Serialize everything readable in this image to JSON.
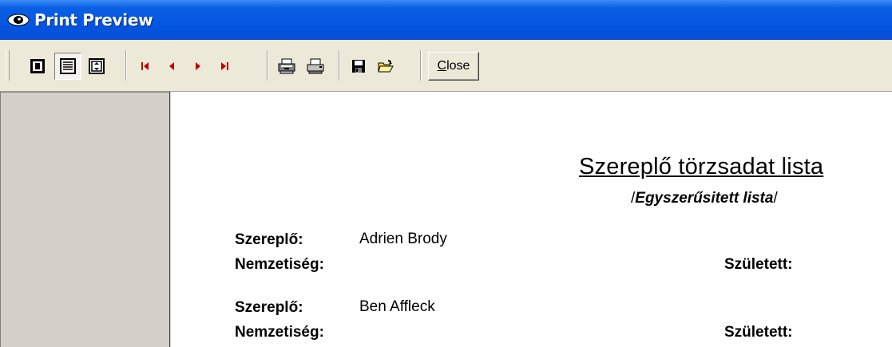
{
  "window": {
    "title": "Print Preview"
  },
  "toolbar": {
    "buttons": [
      {
        "icon": "one-page-icon"
      },
      {
        "icon": "full-width-icon"
      },
      {
        "icon": "fit-page-icon"
      },
      {
        "icon": "first-page-icon"
      },
      {
        "icon": "previous-page-icon"
      },
      {
        "icon": "next-page-icon"
      },
      {
        "icon": "last-page-icon"
      },
      {
        "icon": "print-setup-icon"
      },
      {
        "icon": "print-icon"
      },
      {
        "icon": "save-icon"
      },
      {
        "icon": "open-icon"
      }
    ],
    "close_label_underlined": "C",
    "close_label_rest": "lose"
  },
  "report": {
    "title": "Szereplő törzsadat lista",
    "subtitle_open": "/",
    "subtitle_italic": "Egyszerűsitett lista",
    "subtitle_close": "/",
    "records": [
      {
        "actor_label": "Szereplő:",
        "actor_value": "Adrien Brody",
        "nationality_label": "Nemzetiség:",
        "born_label": "Született:"
      },
      {
        "actor_label": "Szereplő:",
        "actor_value": "Ben Affleck",
        "nationality_label": "Nemzetiség:",
        "born_label": "Született:"
      }
    ]
  },
  "colors": {
    "titlebar": "#0554e0",
    "toolbar": "#ece9d8",
    "navArrows": "#c00000"
  }
}
